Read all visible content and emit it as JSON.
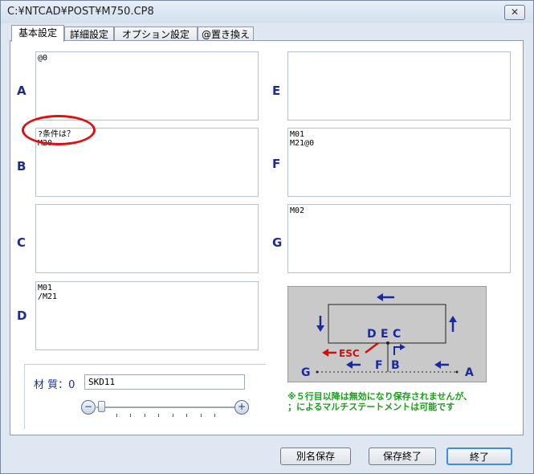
{
  "window": {
    "title": "C:¥NTCAD¥POST¥M750.CP8",
    "close": "✕"
  },
  "tabs": [
    "基本設定",
    "詳細設定",
    "オプション設定",
    "@置き換え"
  ],
  "slots": {
    "A": {
      "label": "A",
      "text": "@0"
    },
    "B": {
      "label": "B",
      "text": "?条件は？\nM20"
    },
    "C": {
      "label": "C",
      "text": ""
    },
    "D": {
      "label": "D",
      "text": "M01\n/M21"
    },
    "E": {
      "label": "E",
      "text": ""
    },
    "F": {
      "label": "F",
      "text": "M01\nM21@0"
    },
    "G": {
      "label": "G",
      "text": "M02"
    }
  },
  "annotation": "?条件は？",
  "material": {
    "label": "材 質：0",
    "value": "SKD11"
  },
  "zoom": {
    "minus": "−",
    "plus": "+",
    "level": 0
  },
  "diagram": {
    "labels": {
      "A": "A",
      "B": "B",
      "C": "C",
      "D": "D",
      "E": "E",
      "F": "F",
      "G": "G",
      "esc": "ESC"
    },
    "colors": {
      "arrow": "#1a2a9c",
      "esc": "#d01010"
    }
  },
  "note": {
    "line1": "※５行目以降は無効になり保存されませんが、",
    "line2": "；によるマルチステートメントは可能です"
  },
  "buttons": {
    "save_as": "別名保存",
    "save_exit": "保存終了",
    "exit": "終了"
  }
}
